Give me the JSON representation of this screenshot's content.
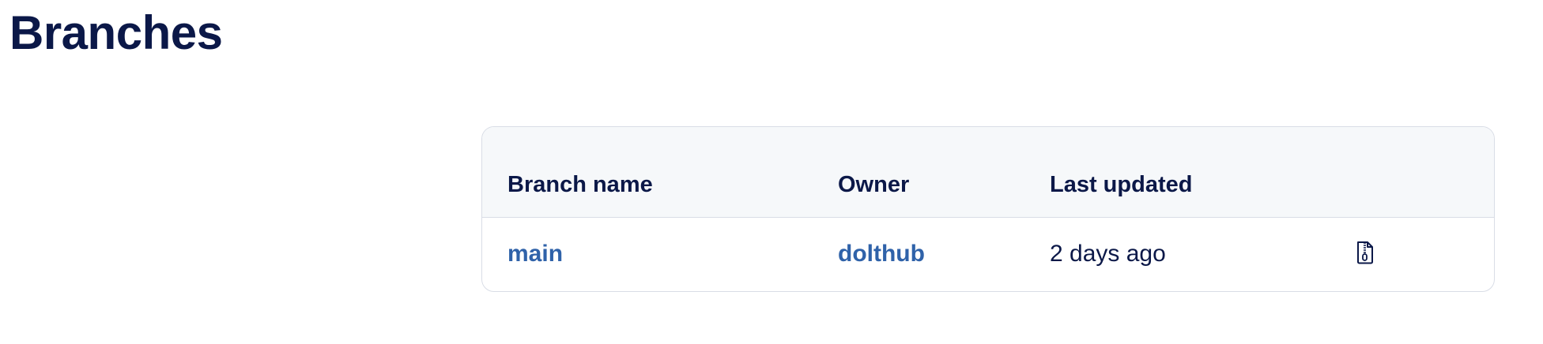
{
  "page": {
    "title": "Branches"
  },
  "table": {
    "columns": [
      "Branch name",
      "Owner",
      "Last updated"
    ],
    "rows": [
      {
        "branch_name": "main",
        "owner": "dolthub",
        "last_updated": "2 days ago",
        "action_icon": "zip-file-icon"
      }
    ]
  },
  "colors": {
    "heading": "#0b1848",
    "link": "#2f62a9",
    "header_bg": "#f6f8fa",
    "border": "#d9dde6"
  }
}
